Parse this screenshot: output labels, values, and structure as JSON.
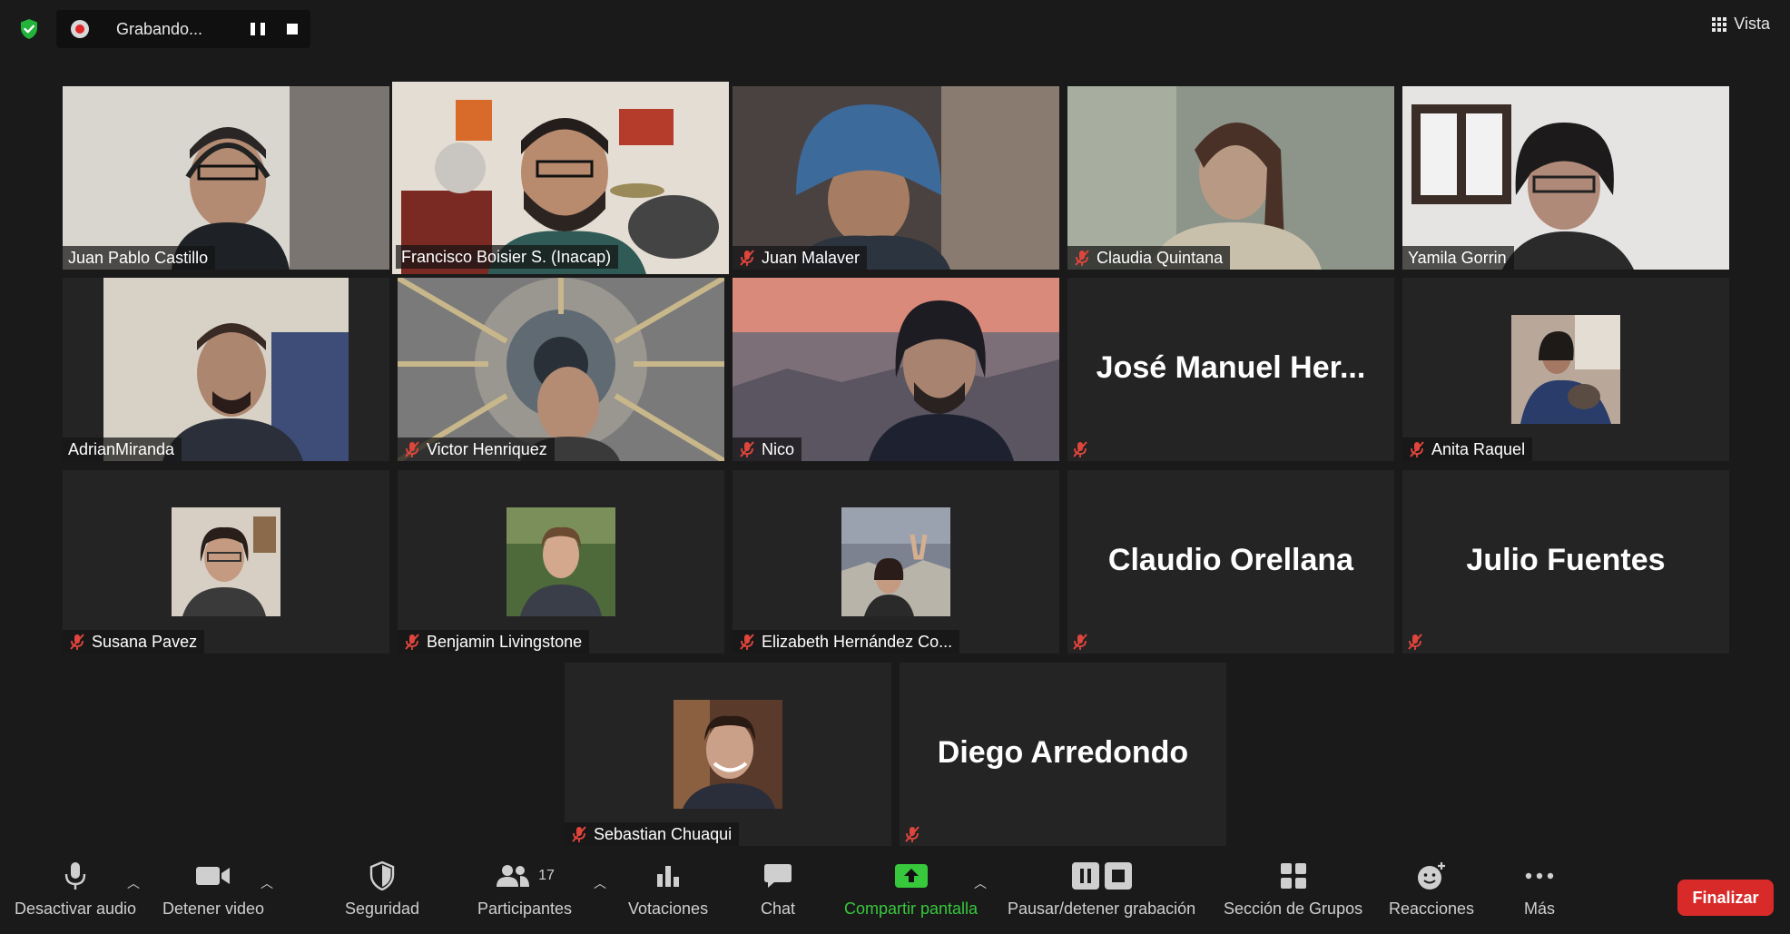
{
  "recording": {
    "label": "Grabando..."
  },
  "view_button": {
    "label": "Vista"
  },
  "participants": [
    {
      "name": "Juan Pablo Castillo",
      "muted": false,
      "video": true
    },
    {
      "name": "Francisco Boisier S. (Inacap)",
      "muted": false,
      "video": true,
      "active_speaker": true
    },
    {
      "name": "Juan Malaver",
      "muted": true,
      "video": true
    },
    {
      "name": "Claudia Quintana",
      "muted": true,
      "video": true
    },
    {
      "name": "Yamila Gorrin",
      "muted": false,
      "video": true
    },
    {
      "name": "AdrianMiranda",
      "muted": false,
      "video": true
    },
    {
      "name": "Victor Henriquez",
      "muted": true,
      "video": true
    },
    {
      "name": "Nico",
      "muted": true,
      "video": true
    },
    {
      "display_name": "José Manuel Her...",
      "muted": true,
      "video": false
    },
    {
      "name": "Anita Raquel",
      "muted": true,
      "video": false,
      "avatar": true
    },
    {
      "name": "Susana Pavez",
      "muted": true,
      "video": false,
      "avatar": true
    },
    {
      "name": "Benjamin Livingstone",
      "muted": true,
      "video": false,
      "avatar": true
    },
    {
      "name": "Elizabeth Hernández Co...",
      "muted": true,
      "video": false,
      "avatar": true
    },
    {
      "display_name": "Claudio Orellana",
      "muted": true,
      "video": false
    },
    {
      "display_name": "Julio Fuentes",
      "muted": true,
      "video": false
    },
    {
      "name": "Sebastian Chuaqui",
      "muted": true,
      "video": false,
      "avatar": true
    },
    {
      "display_name": "Diego Arredondo",
      "muted": true,
      "video": false
    }
  ],
  "toolbar": {
    "audio_label": "Desactivar audio",
    "video_label": "Detener video",
    "security_label": "Seguridad",
    "participants_label": "Participantes",
    "participants_count": "17",
    "polls_label": "Votaciones",
    "chat_label": "Chat",
    "share_label": "Compartir pantalla",
    "record_label": "Pausar/detener grabación",
    "breakout_label": "Sección de Grupos",
    "reactions_label": "Reacciones",
    "more_label": "Más",
    "end_label": "Finalizar"
  },
  "colors": {
    "background": "#1a1a1a",
    "tile": "#242424",
    "active_speaker_border": "#e8f07a",
    "mute_red": "#e0453c",
    "share_green": "#37c83c",
    "end_red": "#d92a2a"
  }
}
